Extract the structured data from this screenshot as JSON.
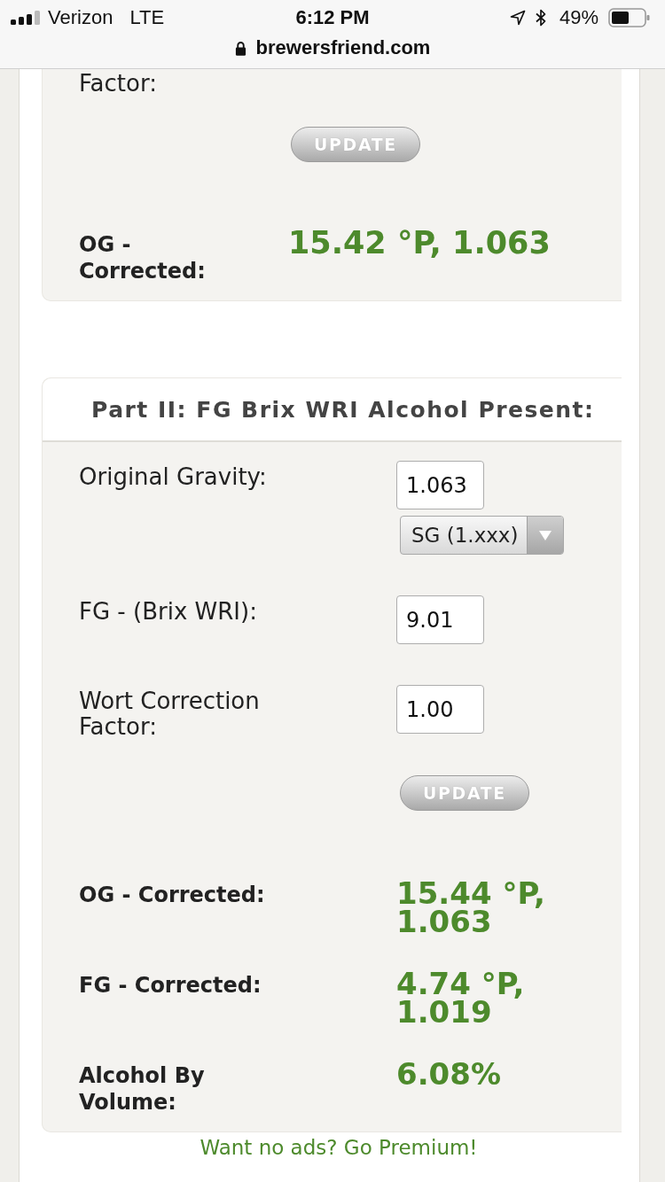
{
  "status_bar": {
    "carrier": "Verizon",
    "network": "LTE",
    "time": "6:12 PM",
    "battery": "49%"
  },
  "address_bar": {
    "url": "brewersfriend.com"
  },
  "sections": [
    {
      "fields": [
        {
          "label": "Factor:"
        }
      ],
      "button": "UPDATE",
      "results": [
        {
          "label": "OG - Corrected:",
          "value": "15.42 °P, 1.063"
        }
      ]
    },
    {
      "title": "Part II: FG Brix WRI Alcohol Present:",
      "fields": [
        {
          "label": "Original Gravity:",
          "value": "1.063",
          "unit": "SG (1.xxx)"
        },
        {
          "label": "FG - (Brix WRI):",
          "value": "9.01"
        },
        {
          "label": "Wort Correction Factor:",
          "value": "1.00"
        }
      ],
      "button": "UPDATE",
      "results": [
        {
          "label": "OG - Corrected:",
          "value": "15.44 °P, 1.063"
        },
        {
          "label": "FG - Corrected:",
          "value": "4.74 °P, 1.019"
        },
        {
          "label": "Alcohol By Volume:",
          "value": "6.08%"
        }
      ]
    }
  ],
  "footer_link": "Want no ads? Go Premium!"
}
